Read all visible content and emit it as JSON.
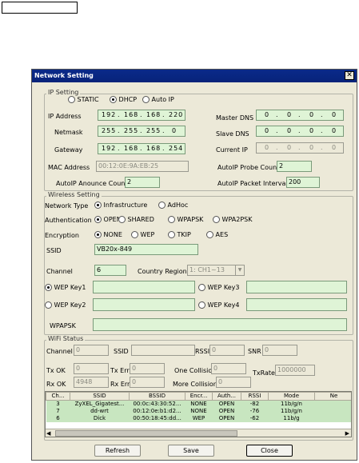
{
  "window": {
    "title": "Network Setting",
    "close_glyph": "✕"
  },
  "ip_setting": {
    "group_label": "IP Setting",
    "modes": [
      {
        "label": "STATIC",
        "selected": false
      },
      {
        "label": "DHCP",
        "selected": true
      },
      {
        "label": "Auto IP",
        "selected": false
      }
    ],
    "ip_address_label": "IP Address",
    "ip_address": [
      "192",
      "168",
      "168",
      "220"
    ],
    "netmask_label": "Netmask",
    "netmask": [
      "255",
      "255",
      "255",
      "0"
    ],
    "gateway_label": "Gateway",
    "gateway": [
      "192",
      "168",
      "168",
      "254"
    ],
    "master_dns_label": "Master DNS",
    "master_dns": [
      "0",
      "0",
      "0",
      "0"
    ],
    "slave_dns_label": "Slave DNS",
    "slave_dns": [
      "0",
      "0",
      "0",
      "0"
    ],
    "current_ip_label": "Current IP",
    "current_ip": [
      "0",
      "0",
      "0",
      "0"
    ],
    "mac_label": "MAC Address",
    "mac_value": "00:12:0E:9A:EB:25",
    "autoip_probe_label": "AutoIP Probe Count",
    "autoip_probe_value": "2",
    "autoip_announce_label": "AutoIP Anounce Count",
    "autoip_announce_value": "2",
    "autoip_interval_label": "AutoIP Packet Interval",
    "autoip_interval_value": "200"
  },
  "wireless": {
    "group_label": "Wireless Setting",
    "network_type_label": "Network Type",
    "network_types": [
      {
        "label": "Infrastructure",
        "selected": true
      },
      {
        "label": "AdHoc",
        "selected": false
      }
    ],
    "auth_label": "Authentication",
    "auth_options": [
      {
        "label": "OPEN",
        "selected": true
      },
      {
        "label": "SHARED",
        "selected": false
      },
      {
        "label": "WPAPSK",
        "selected": false
      },
      {
        "label": "WPA2PSK",
        "selected": false
      }
    ],
    "encryption_label": "Encryption",
    "encryption_options": [
      {
        "label": "NONE",
        "selected": true
      },
      {
        "label": "WEP",
        "selected": false
      },
      {
        "label": "TKIP",
        "selected": false
      },
      {
        "label": "AES",
        "selected": false
      }
    ],
    "ssid_label": "SSID",
    "ssid_value": "VB20x-849",
    "channel_label": "Channel",
    "channel_value": "6",
    "country_label": "Country Region",
    "country_value": "1: CH1~13",
    "wep_key1_label": "WEP Key1",
    "wep_key2_label": "WEP Key2",
    "wep_key3_label": "WEP Key3",
    "wep_key4_label": "WEP Key4",
    "wpapsk_label": "WPAPSK"
  },
  "wifi_status": {
    "group_label": "WiFi Status",
    "channel_label": "Channel",
    "channel_value": "0",
    "ssid_label": "SSID",
    "ssid_value": "",
    "rssi_label": "RSSI",
    "rssi_value": "0",
    "snr_label": "SNR",
    "snr_value": "0",
    "tx_ok_label": "Tx OK",
    "tx_ok_value": "0",
    "tx_err_label": "Tx Err",
    "tx_err_value": "0",
    "one_collision_label": "One Collision",
    "one_collision_value": "0",
    "tx_rate_label": "TxRate",
    "tx_rate_value": "1000000",
    "rx_ok_label": "Rx OK",
    "rx_ok_value": "4948",
    "rx_err_label": "Rx Err",
    "rx_err_value": "0",
    "more_collisions_label": "More Collisions",
    "more_collisions_value": "0"
  },
  "scan_table": {
    "headers": [
      "Ch...",
      "SSID",
      "BSSID",
      "Encr...",
      "Auth...",
      "RSSI",
      "Mode",
      "Ne"
    ],
    "rows": [
      [
        "3",
        "ZyXEL_Gigatest...",
        "00:0c:43:30:52...",
        "NONE",
        "OPEN",
        "-82",
        "11b/g/n",
        ""
      ],
      [
        "7",
        "dd-wrt",
        "00:12:0e:b1:d2...",
        "NONE",
        "OPEN",
        "-76",
        "11b/g/n",
        ""
      ],
      [
        "6",
        "Dick",
        "00:50:18:45:dd...",
        "WEP",
        "OPEN",
        "-62",
        "11b/g",
        ""
      ]
    ]
  },
  "buttons": {
    "refresh": "Refresh",
    "save": "Save",
    "close": "Close"
  }
}
